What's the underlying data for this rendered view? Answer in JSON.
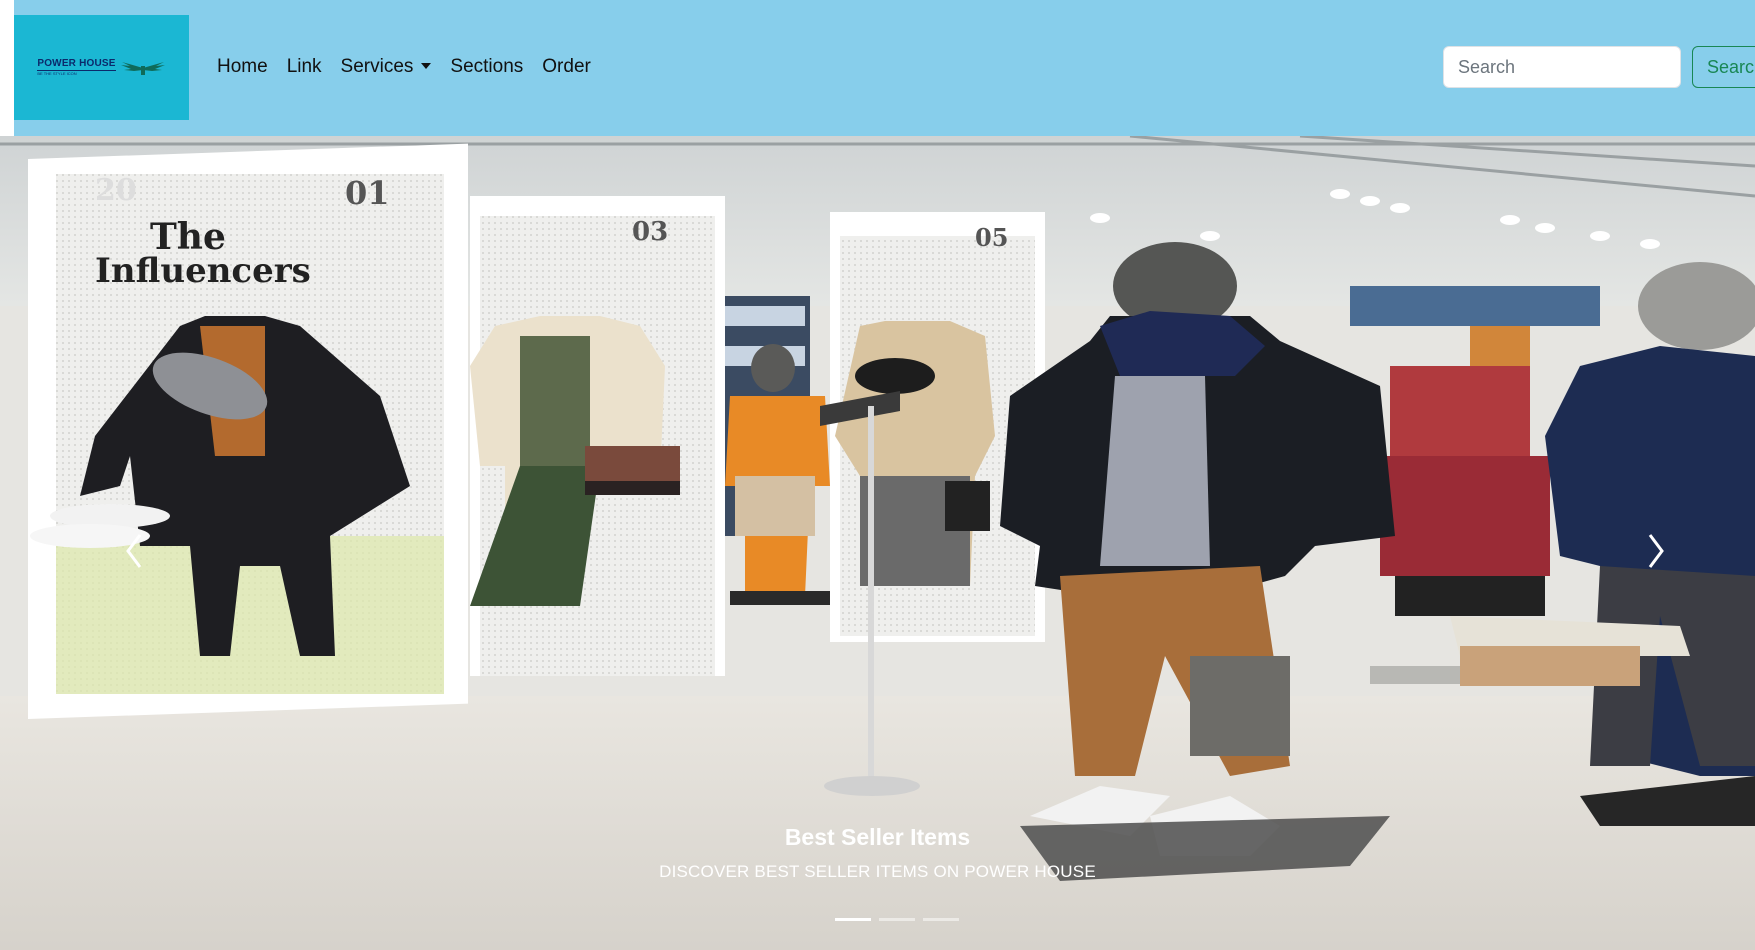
{
  "navbar": {
    "background": "#87CEEB",
    "brand": {
      "name": "POWER HOUSE",
      "tagline": "BE THE STYLE ICON",
      "background": "#1BB7D3"
    },
    "links": [
      {
        "label": "Home"
      },
      {
        "label": "Link"
      },
      {
        "label": "Services",
        "dropdown": true
      },
      {
        "label": "Sections"
      },
      {
        "label": "Order"
      }
    ],
    "search": {
      "placeholder": "Search",
      "button_label": "Search",
      "button_color": "#198754"
    }
  },
  "carousel": {
    "caption_title": "Best Seller Items",
    "caption_text": "DISCOVER BEST SELLER ITEMS ON POWER HOUSE",
    "panel_texts": {
      "panel1_number": "01",
      "panel1_title_line1": "The",
      "panel1_title_line2": "Influencers",
      "panel2_number": "03",
      "panel3_number": "05"
    },
    "slide_count": 3,
    "active_slide": 1,
    "prev_icon": "chevron-left-icon",
    "next_icon": "chevron-right-icon"
  }
}
